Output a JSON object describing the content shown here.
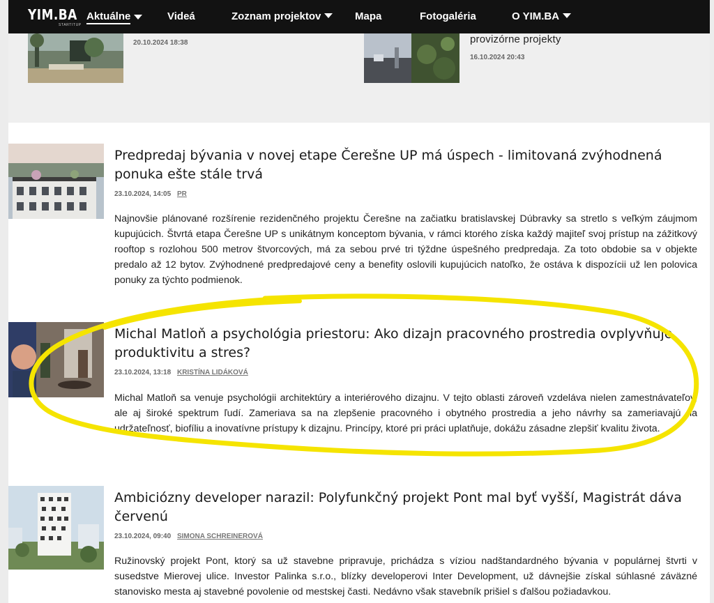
{
  "nav": {
    "logo": "YIM.BA",
    "logo_sub": "STARTITUP",
    "items": [
      {
        "label": "Aktuálne",
        "dropdown": true
      },
      {
        "label": "Videá",
        "dropdown": false
      },
      {
        "label": "Zoznam projektov",
        "dropdown": true
      },
      {
        "label": "Mapa",
        "dropdown": false
      },
      {
        "label": "Fotogaléria",
        "dropdown": false
      },
      {
        "label": "O YIM.BA",
        "dropdown": true
      }
    ]
  },
  "top_cards": [
    {
      "date": "20.10.2024 18:38"
    },
    {
      "title_tail": "provizórne projekty",
      "date": "16.10.2024 20:43"
    }
  ],
  "articles": [
    {
      "title": "Predpredaj bývania v novej etape Čerešne UP má úspech - limitovaná zvýhodnená ponuka ešte stále trvá",
      "date": "23.10.2024, 14:05",
      "author": "PR",
      "text": "Najnovšie plánované rozšírenie rezidenčného projektu Čerešne na začiatku bratislavskej Dúbravky sa stretlo s veľkým záujmom kupujúcich. Štvrtá etapa Čerešne UP s unikátnym konceptom bývania, v rámci ktorého získa každý majiteľ svoj prístup na zážitkový rooftop s rozlohou 500 metrov štvorcových, má za sebou prvé tri týždne úspešného predpredaja. Za toto obdobie sa v objekte predalo až 12 bytov. Zvýhodnené predpredajové ceny a benefity oslovili kupujúcich natoľko, že ostáva k dispozícii už len polovica ponuky za týchto podmienok."
    },
    {
      "title": "Michal Matloň a psychológia priestoru: Ako dizajn pracovného prostredia ovplyvňuje produktivitu a stres?",
      "date": "23.10.2024, 13:18",
      "author": "Kristína Lidáková",
      "text": "Michal Matloň sa venuje psychológii architektúry a interiérového dizajnu. V tejto oblasti zároveň vzdeláva nielen zamestnávateľov, ale aj široké spektrum ľudí. Zameriava sa na zlepšenie pracovného i obytného prostredia a jeho návrhy sa zameriavajú na udržateľnosť, biofíliu a inovatívne prístupy k dizajnu. Princípy, ktoré pri práci uplatňuje, dokážu zásadne zlepšiť kvalitu života."
    },
    {
      "title": "Ambiciózny developer narazil: Polyfunkčný projekt Pont mal byť vyšší, Magistrát dáva červenú",
      "date": "23.10.2024, 09:40",
      "author": "Simona Schreinerová",
      "text": "Ružinovský projekt Pont, ktorý sa už stavebne pripravuje, prichádza s víziou nadštandardného bývania v populárnej štvrti v susedstve Mierovej ulice. Investor Palinka s.r.o., blízky developerovi Inter Development, už dávnejšie získal súhlasné záväzné stanovisko mesta aj stavebné povolenie od mestskej časti. Nedávno však stavebník prišiel s ďalšou požiadavkou."
    }
  ],
  "colors": {
    "nav_bg": "#121212",
    "highlight": "#f5e400"
  }
}
